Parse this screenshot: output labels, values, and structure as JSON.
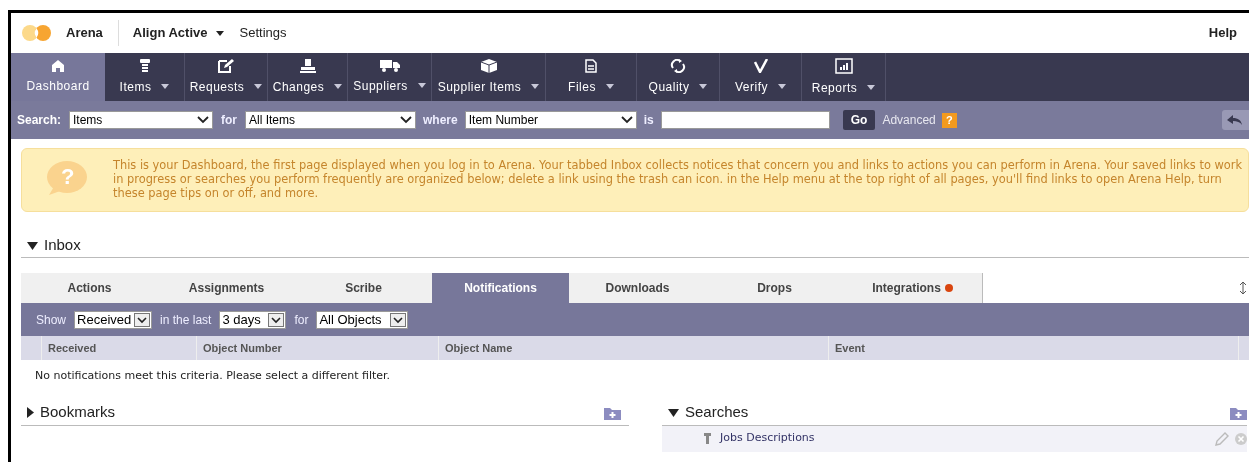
{
  "header": {
    "app_name": "Arena",
    "workspace": "Align Active",
    "settings": "Settings",
    "help": "Help"
  },
  "nav": [
    {
      "label": "Dashboard",
      "selected": true,
      "dropdown": false
    },
    {
      "label": "Items",
      "selected": false,
      "dropdown": true
    },
    {
      "label": "Requests",
      "selected": false,
      "dropdown": true
    },
    {
      "label": "Changes",
      "selected": false,
      "dropdown": true
    },
    {
      "label": "Suppliers",
      "selected": false,
      "dropdown": true
    },
    {
      "label": "Supplier Items",
      "selected": false,
      "dropdown": true
    },
    {
      "label": "Files",
      "selected": false,
      "dropdown": true
    },
    {
      "label": "Quality",
      "selected": false,
      "dropdown": true
    },
    {
      "label": "Verify",
      "selected": false,
      "dropdown": true
    },
    {
      "label": "Reports",
      "selected": false,
      "dropdown": true
    }
  ],
  "search_bar": {
    "label": "Search:",
    "type": "Items",
    "for_label": "for",
    "scope": "All Items",
    "where_label": "where",
    "field": "Item Number",
    "is_label": "is",
    "go": "Go",
    "advanced": "Advanced",
    "help_badge": "?"
  },
  "tip": {
    "icon_glyph": "?",
    "text": "This is your Dashboard, the first page displayed when you log in to Arena. Your tabbed Inbox collects notices that concern you and links to actions you can perform in Arena. Your saved links to work in progress or searches you perform frequently are organized below; delete a link using the trash can icon. in the Help menu at the top right of all pages, you'll find links to open Arena Help, turn these page tips on or off, and more."
  },
  "inbox": {
    "title": "Inbox",
    "expanded": true,
    "tabs": [
      {
        "label": "Actions",
        "selected": false,
        "alert": false
      },
      {
        "label": "Assignments",
        "selected": false,
        "alert": false
      },
      {
        "label": "Scribe",
        "selected": false,
        "alert": false
      },
      {
        "label": "Notifications",
        "selected": true,
        "alert": false
      },
      {
        "label": "Downloads",
        "selected": false,
        "alert": false
      },
      {
        "label": "Drops",
        "selected": false,
        "alert": false
      },
      {
        "label": "Integrations",
        "selected": false,
        "alert": true
      }
    ],
    "filter": {
      "show_label": "Show",
      "show": "Received",
      "last_label": "in the last",
      "period": "3 days",
      "for_label": "for",
      "objects": "All Objects"
    },
    "columns": [
      "Received",
      "Object Number",
      "Object Name",
      "Event"
    ],
    "empty_message": "No notifications meet this criteria. Please select a different filter."
  },
  "bookmarks": {
    "title": "Bookmarks",
    "expanded": false
  },
  "searches": {
    "title": "Searches",
    "expanded": true,
    "items": [
      {
        "label": "Jobs Descriptions"
      }
    ]
  }
}
